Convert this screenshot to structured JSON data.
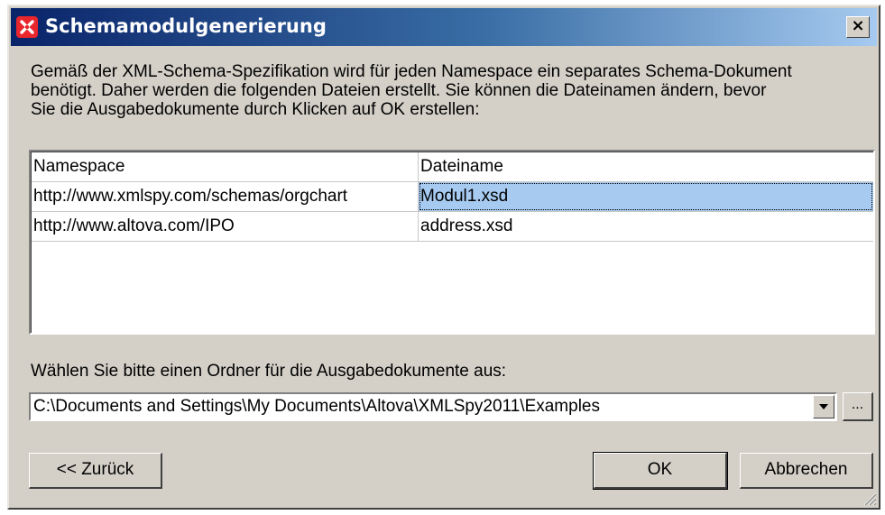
{
  "window": {
    "title": "Schemamodulgenerierung",
    "close_label": "×"
  },
  "description": "Gemäß der XML-Schema-Spezifikation wird für jeden Namespace ein separates Schema-Dokument\nbenötigt. Daher werden die folgenden Dateien erstellt. Sie können die Dateinamen ändern, bevor\nSie die Ausgabedokumente durch Klicken auf OK erstellen:",
  "table": {
    "headers": [
      "Namespace",
      "Dateiname"
    ],
    "rows": [
      {
        "namespace": "http://www.xmlspy.com/schemas/orgchart",
        "filename": "Modul1.xsd"
      },
      {
        "namespace": "http://www.altova.com/IPO",
        "filename": "address.xsd"
      }
    ]
  },
  "folder": {
    "label": "Wählen Sie bitte einen Ordner für die Ausgabedokumente aus:",
    "value": "C:\\Documents and Settings\\My Documents\\Altova\\XMLSpy2011\\Examples",
    "browse_label": "..."
  },
  "buttons": {
    "back": "<< Zurück",
    "ok": "OK",
    "cancel": "Abbrechen"
  },
  "colors": {
    "title_gradient_start": "#0a246a",
    "title_gradient_end": "#a6caf0",
    "selection": "#a6caf0",
    "dialog_face": "#d4d0c8",
    "app_icon": "#e8262c"
  }
}
